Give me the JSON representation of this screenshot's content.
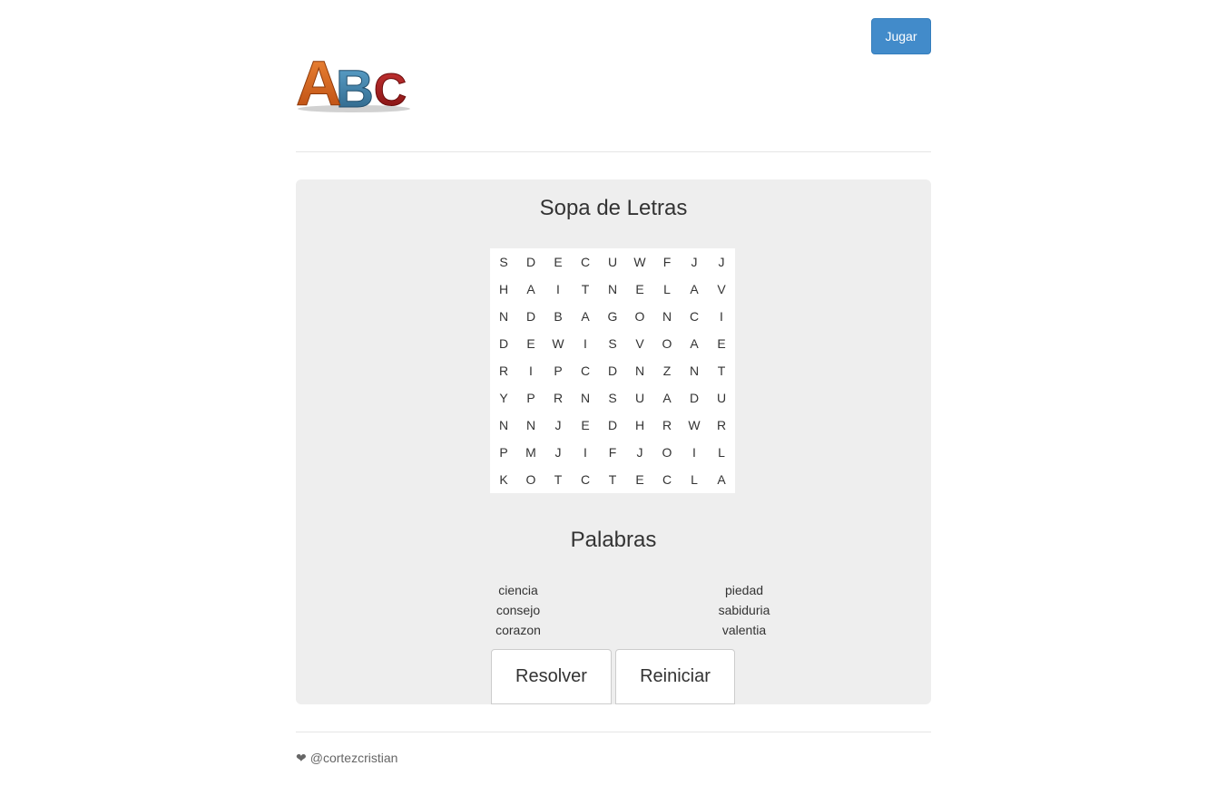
{
  "header": {
    "play_label": "Jugar",
    "logo_letters": [
      "A",
      "B",
      "C"
    ]
  },
  "game": {
    "title": "Sopa de Letras",
    "grid": [
      [
        "S",
        "D",
        "E",
        "C",
        "U",
        "W",
        "F",
        "J",
        "J"
      ],
      [
        "H",
        "A",
        "I",
        "T",
        "N",
        "E",
        "L",
        "A",
        "V"
      ],
      [
        "N",
        "D",
        "B",
        "A",
        "G",
        "O",
        "N",
        "C",
        "I"
      ],
      [
        "D",
        "E",
        "W",
        "I",
        "S",
        "V",
        "O",
        "A",
        "E"
      ],
      [
        "R",
        "I",
        "P",
        "C",
        "D",
        "N",
        "Z",
        "N",
        "T"
      ],
      [
        "Y",
        "P",
        "R",
        "N",
        "S",
        "U",
        "A",
        "D",
        "U"
      ],
      [
        "N",
        "N",
        "J",
        "E",
        "D",
        "H",
        "R",
        "W",
        "R"
      ],
      [
        "P",
        "M",
        "J",
        "I",
        "F",
        "J",
        "O",
        "I",
        "L"
      ],
      [
        "K",
        "O",
        "T",
        "C",
        "T",
        "E",
        "C",
        "L",
        "A"
      ]
    ],
    "words_title": "Palabras",
    "words_left": [
      "ciencia",
      "consejo",
      "corazon"
    ],
    "words_right": [
      "piedad",
      "sabiduria",
      "valentia"
    ],
    "solve_label": "Resolver",
    "reset_label": "Reiniciar"
  },
  "footer": {
    "icon": "heart-icon",
    "credit": "@cortezcristian"
  },
  "colors": {
    "primary": "#428bca",
    "panel": "#eeeeee",
    "logo_a": "#e06a1c",
    "logo_b": "#3b7fa8",
    "logo_c": "#a81c1c"
  }
}
